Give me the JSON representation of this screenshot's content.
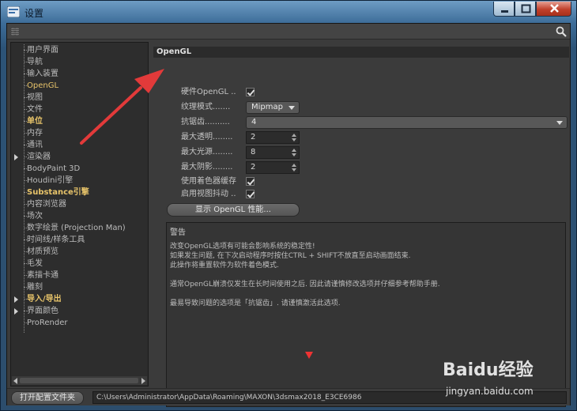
{
  "window": {
    "title": "设置"
  },
  "tree": {
    "items": [
      {
        "label": "用户界面",
        "style": ""
      },
      {
        "label": "导航",
        "style": ""
      },
      {
        "label": "输入装置",
        "style": ""
      },
      {
        "label": "OpenGL",
        "style": "hl"
      },
      {
        "label": "视图",
        "style": ""
      },
      {
        "label": "文件",
        "style": ""
      },
      {
        "label": "单位",
        "style": "bold"
      },
      {
        "label": "内存",
        "style": ""
      },
      {
        "label": "通讯",
        "style": ""
      },
      {
        "label": "渲染器",
        "style": "exp"
      },
      {
        "label": "BodyPaint 3D",
        "style": ""
      },
      {
        "label": "Houdini引擎",
        "style": ""
      },
      {
        "label": "Substance引擎",
        "style": "bold"
      },
      {
        "label": "内容浏览器",
        "style": ""
      },
      {
        "label": "场次",
        "style": ""
      },
      {
        "label": "数字绘景 (Projection Man)",
        "style": ""
      },
      {
        "label": "时间线/样条工具",
        "style": ""
      },
      {
        "label": "材质预览",
        "style": ""
      },
      {
        "label": "毛发",
        "style": ""
      },
      {
        "label": "素描卡通",
        "style": ""
      },
      {
        "label": "雕刻",
        "style": ""
      },
      {
        "label": "导入/导出",
        "style": "exp bold"
      },
      {
        "label": "界面颜色",
        "style": "exp"
      },
      {
        "label": "ProRender",
        "style": ""
      }
    ]
  },
  "opengl": {
    "section_title": "OpenGL",
    "hw_opengl_label": "硬件OpenGL ..",
    "texture_mode_label": "纹理模式.......",
    "texture_mode_value": "Mipmap",
    "antialias_label": "抗锯齿..........",
    "antialias_value": "4",
    "max_transparency_label": "最大透明........",
    "max_transparency_value": "2",
    "max_lights_label": "最大光源........",
    "max_lights_value": "8",
    "max_shadows_label": "最大阴影........",
    "max_shadows_value": "2",
    "use_shader_cache_label": "使用着色器缓存",
    "enable_view_jitter_label": "启用视图抖动 ..",
    "show_performance_button": "显示 OpenGL 性能..."
  },
  "warning": {
    "title": "警告",
    "line1": "改变OpenGL选项有可能会影响系统的稳定性!",
    "line2": "如果发生问题, 在下次启动程序时按住CTRL + SHIFT不放直至启动画面结束.",
    "line3": "此操作将重置软件为软件着色模式.",
    "line4": "通常OpenGL崩溃仅发生在长时间使用之后. 因此请谨慎修改选项并仔细参考帮助手册.",
    "line5": "最易导致问题的选项是「抗锯齿」. 请谨慎激活此选项."
  },
  "bottom": {
    "open_folder_button": "打开配置文件夹",
    "path": "C:\\Users\\Administrator\\AppData\\Roaming\\MAXON\\3dsmax2018_E3CE6986"
  },
  "watermark": {
    "logo": "Baidu经验",
    "url": "jingyan.baidu.com"
  },
  "colors": {
    "highlight": "#e8c46a",
    "annotation_arrow": "#e23a3a"
  }
}
